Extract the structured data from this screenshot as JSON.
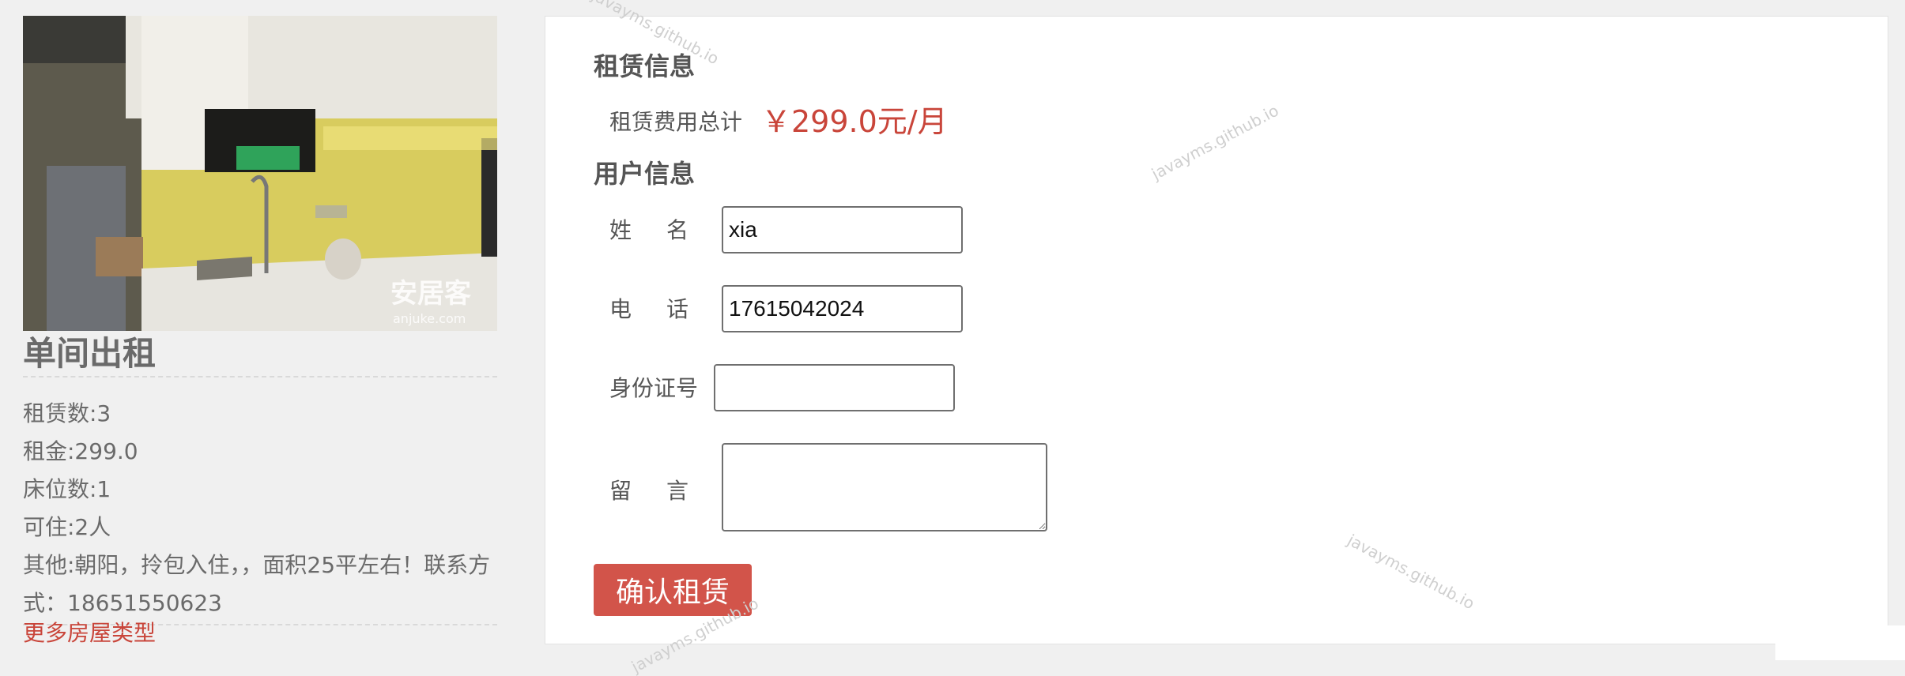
{
  "house": {
    "title": "单间出租",
    "photo_logo_cn": "安居客",
    "photo_logo_en": "anjuke.com",
    "rent_count": "租赁数:3",
    "rent_price": "租金:299.0",
    "beds": "床位数:1",
    "capacity": "可住:2人",
    "other": "其他:朝阳，拎包入住，，面积25平左右！联系方式：18651550623",
    "more_link": "更多房屋类型"
  },
  "rental": {
    "section_title": "租赁信息",
    "fee_label": "租赁费用总计",
    "fee_value": "￥299.0元/月"
  },
  "user": {
    "section_title": "用户信息",
    "name_label": "姓名",
    "name_value": "xia",
    "phone_label": "电话",
    "phone_value": "17615042024",
    "id_label": "身份证号",
    "id_value": "",
    "message_label": "留言",
    "message_value": ""
  },
  "actions": {
    "confirm_label": "确认租赁"
  },
  "watermark": {
    "text": "javayms.github.io"
  },
  "colors": {
    "accent": "#c9453a",
    "button": "#d2544a",
    "page_bg": "#f0f0f0"
  }
}
